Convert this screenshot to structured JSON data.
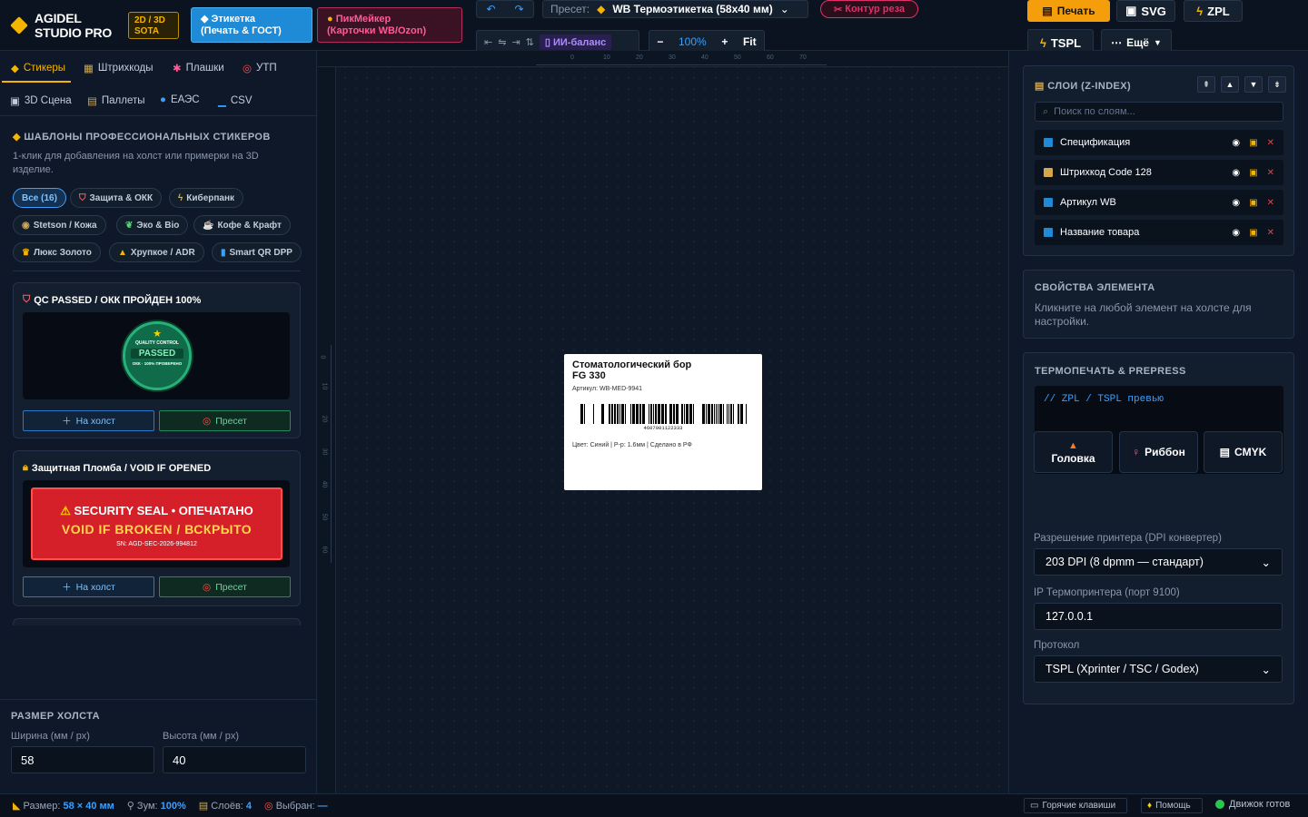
{
  "app": {
    "name_line1": "AGIDEL",
    "name_line2": "STUDIO PRO",
    "badge_line1": "2D / 3D",
    "badge_line2": "SOTA"
  },
  "modes": [
    {
      "label1": "Этикетка",
      "label2": "(Печать & ГОСТ)"
    },
    {
      "label1": "ПикМейкер",
      "label2": "(Карточки WB/Ozon)"
    }
  ],
  "preset": {
    "label": "Пресет:",
    "value": "WB Термоэтикетка (58x40 мм)"
  },
  "contour": "Контур реза",
  "ai_balance": "ИИ-баланс",
  "zoom": {
    "minus": "−",
    "value": "100%",
    "plus": "+",
    "fit": "Fit"
  },
  "actions": {
    "print": "Печать",
    "svg": "SVG",
    "zpl": "ZPL",
    "tspl": "TSPL",
    "more": "Ещё"
  },
  "left_tabs": [
    {
      "label": "Стикеры",
      "icon": "sticker-icon",
      "glyph": "◆"
    },
    {
      "label": "Штрихкоды",
      "icon": "barcode-icon",
      "glyph": "▦"
    },
    {
      "label": "Плашки",
      "icon": "ribbon-icon",
      "glyph": "✱"
    },
    {
      "label": "УТП",
      "icon": "target-icon",
      "glyph": "◎"
    },
    {
      "label": "3D Сцена",
      "icon": "building-icon",
      "glyph": "▣"
    },
    {
      "label": "Паллеты",
      "icon": "clipboard-icon",
      "glyph": "▤"
    },
    {
      "label": "ЕАЭС",
      "icon": "globe-icon",
      "glyph": "●"
    },
    {
      "label": "CSV",
      "icon": "chart-icon",
      "glyph": "▁"
    }
  ],
  "templates": {
    "title": "ШАБЛОНЫ ПРОФЕССИОНАЛЬНЫХ СТИКЕРОВ",
    "desc": "1-клик для добавления на холст или примерки на 3D изделие.",
    "chips": [
      "Все (16)",
      "Защита & ОКК",
      "Киберпанк",
      "Stetson / Кожа",
      "Эко & Bio",
      "Кофе & Крафт",
      "Люкс Золото",
      "Хрупкое / ADR",
      "Smart QR DPP"
    ],
    "cards": [
      {
        "title": "QC PASSED / ОКК ПРОЙДЕН 100%",
        "seal_top": "QUALITY CONTROL",
        "seal_mid": "PASSED",
        "seal_bot": "ОКК · 100% ПРОВЕРЕНО",
        "btn_canvas": "На холст",
        "btn_preset": "Пресет"
      },
      {
        "title": "Защитная Пломба / VOID IF OPENED",
        "line1": "SECURITY SEAL • ОПЕЧАТАНО",
        "line2": "VOID IF BROKEN / ВСКРЫТО",
        "serial": "SN: AGD-SEC-2026-994812",
        "btn_canvas": "На холст",
        "btn_preset": "Пресет"
      }
    ]
  },
  "canvas_size": {
    "title": "РАЗМЕР ХОЛСТА",
    "width_label": "Ширина (мм / px)",
    "height_label": "Высота (мм / px)",
    "width": "58",
    "height": "40"
  },
  "ruler_h": [
    "0",
    "10",
    "20",
    "30",
    "40",
    "50",
    "60",
    "70"
  ],
  "ruler_v": [
    "0",
    "10",
    "20",
    "30",
    "40",
    "50",
    "60"
  ],
  "sticker": {
    "title1": "Стоматологический бор",
    "title2": "FG 330",
    "article": "Артикул: WB-MED-9941",
    "barcode_num": "4607001122333",
    "footer": "Цвет: Синий | Р-р: 1.6мм | Сделано в РФ"
  },
  "layers": {
    "title": "СЛОИ (Z-INDEX)",
    "search_placeholder": "Поиск по слоям...",
    "items": [
      "Спецификация",
      "Штрихкод Code 128",
      "Артикул WB",
      "Название товара"
    ]
  },
  "props": {
    "title": "СВОЙСТВА ЭЛЕМЕНТА",
    "desc": "Кликните на любой элемент на холсте для настройки."
  },
  "thermo": {
    "title": "ТЕРМОПЕЧАТЬ & PREPRESS",
    "code": "// ZPL / TSPL превью",
    "btn_head": "Головка",
    "btn_ribbon": "Риббон",
    "btn_cmyk": "CMYK",
    "dpi_label": "Разрешение принтера (DPI конвертер)",
    "dpi_value": "203 DPI (8 dpmm — стандарт)",
    "ip_label": "IP Термопринтера (порт 9100)",
    "ip_value": "127.0.0.1",
    "proto_label": "Протокол",
    "proto_value": "TSPL (Xprinter / TSC / Godex)"
  },
  "status": {
    "size_label": "Размер:",
    "size_value": "58 × 40 мм",
    "zoom_label": "Зум:",
    "zoom_value": "100%",
    "layers_label": "Слоёв:",
    "layers_value": "4",
    "selected_label": "Выбран:",
    "selected_value": "—",
    "hotkeys": "Горячие клавиши",
    "help": "Помощь",
    "engine": "Движок готов"
  }
}
